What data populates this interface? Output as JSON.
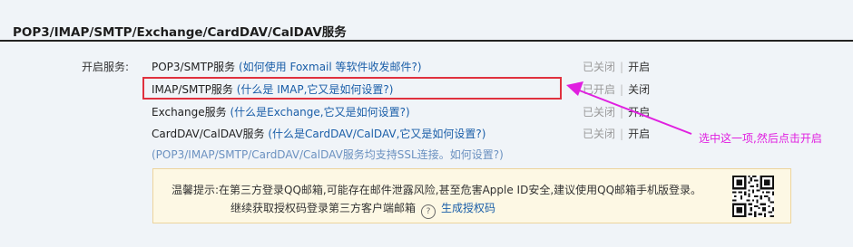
{
  "section": {
    "title": "POP3/IMAP/SMTP/Exchange/CardDAV/CalDAV服务"
  },
  "row_label": "开启服务:",
  "services": [
    {
      "name": "POP3/SMTP服务",
      "help": "(如何使用 Foxmail 等软件收发邮件?)",
      "status": "已关闭",
      "action": "开启"
    },
    {
      "name": "IMAP/SMTP服务",
      "help": "(什么是 IMAP,它又是如何设置?)",
      "status": "已开启",
      "action": "关闭"
    },
    {
      "name": "Exchange服务",
      "help": "(什么是Exchange,它又是如何设置?)",
      "status": "已关闭",
      "action": "开启"
    },
    {
      "name": "CardDAV/CalDAV服务",
      "help": "(什么是CardDAV/CalDAV,它又是如何设置?)",
      "status": "已关闭",
      "action": "开启"
    }
  ],
  "ssl_note": "(POP3/IMAP/SMTP/CardDAV/CalDAV服务均支持SSL连接。如何设置?)",
  "tip": {
    "line1": "温馨提示:在第三方登录QQ邮箱,可能存在邮件泄露风险,甚至危害Apple ID安全,建议使用QQ邮箱手机版登录。",
    "line2": "继续获取授权码登录第三方客户端邮箱",
    "qmark": "?",
    "generate_link": "生成授权码"
  },
  "annotation": "选中这一项,然后点击开启",
  "colors": {
    "highlight": "#e0313e",
    "arrow": "#e020e0",
    "link": "#1a5ea8"
  }
}
